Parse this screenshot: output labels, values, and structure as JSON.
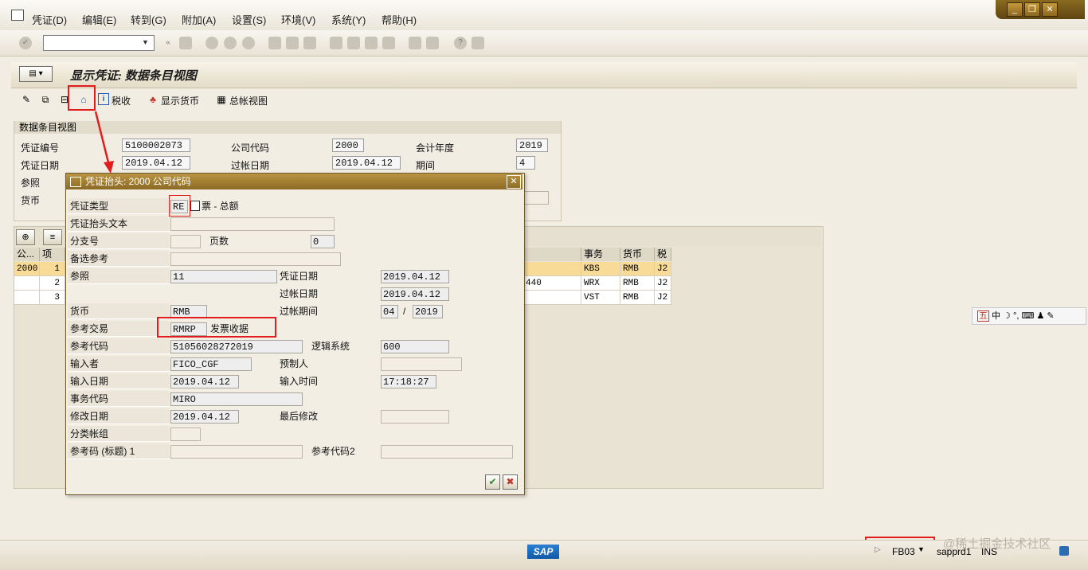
{
  "menu": {
    "items": [
      "凭证(D)",
      "编辑(E)",
      "转到(G)",
      "附加(A)",
      "设置(S)",
      "环境(V)",
      "系统(Y)",
      "帮助(H)"
    ]
  },
  "title": "显示凭证: 数据条目视图",
  "app_toolbar": {
    "tax_label": "税收",
    "show_currency_label": "显示货币",
    "gl_view_label": "总帐视图"
  },
  "header_group": {
    "title": "数据条目视图",
    "doc_no_label": "凭证编号",
    "doc_no": "5100002073",
    "company_label": "公司代码",
    "company": "2000",
    "fiscal_year_label": "会计年度",
    "fiscal_year": "2019",
    "doc_date_label": "凭证日期",
    "doc_date": "2019.04.12",
    "posting_date_label": "过帐日期",
    "posting_date": "2019.04.12",
    "period_label": "期间",
    "period": "4",
    "reference_label": "参照",
    "currency_label": "货币"
  },
  "table": {
    "headers": [
      "公...",
      "项",
      "事务",
      "货币",
      "税"
    ],
    "rows": [
      {
        "company": "2000",
        "item": "1",
        "amount_tail": "",
        "trans": "KBS",
        "curr": "RMB",
        "tax": "J2"
      },
      {
        "company": "",
        "item": "2",
        "amount_tail": "440",
        "trans": "WRX",
        "curr": "RMB",
        "tax": "J2"
      },
      {
        "company": "",
        "item": "3",
        "amount_tail": "",
        "trans": "VST",
        "curr": "RMB",
        "tax": "J2"
      }
    ]
  },
  "dialog": {
    "title": "凭证抬头: 2000 公司代码",
    "doc_type_label": "凭证类型",
    "doc_type": "RE",
    "doc_type_desc": "票 - 总额",
    "header_text_label": "凭证抬头文本",
    "branch_label": "分支号",
    "pages_label": "页数",
    "pages": "0",
    "alt_ref_label": "备选参考",
    "reference_label": "参照",
    "reference": "11",
    "doc_date_label": "凭证日期",
    "doc_date": "2019.04.12",
    "posting_date_label": "过帐日期",
    "posting_date": "2019.04.12",
    "currency_label": "货币",
    "currency": "RMB",
    "posting_period_label": "过帐期间",
    "posting_period": "04",
    "posting_year": "2019",
    "ref_trans_label": "参考交易",
    "ref_trans": "RMRP",
    "ref_trans_desc": "发票收据",
    "ref_key_label": "参考代码",
    "ref_key": "51056028272019",
    "logical_system_label": "逻辑系统",
    "logical_system": "600",
    "entered_by_label": "输入者",
    "entered_by": "FICO_CGF",
    "parked_by_label": "预制人",
    "entry_date_label": "输入日期",
    "entry_date": "2019.04.12",
    "entry_time_label": "输入时间",
    "entry_time": "17:18:27",
    "tcode_label": "事务代码",
    "tcode": "MIRO",
    "changed_on_label": "修改日期",
    "changed_on": "2019.04.12",
    "last_change_label": "最后修改",
    "ledger_group_label": "分类帐组",
    "ref_key_h1_label": "参考码 (标题) 1",
    "ref_key2_label": "参考代码2"
  },
  "status": {
    "sap": "SAP",
    "tcode": "FB03",
    "server": "sapprd1",
    "mode": "INS",
    "watermark": "@稀土掘金技术社区"
  },
  "ime": {
    "label": "五中"
  },
  "colors": {
    "annotation": "#e21c1c",
    "title_bar": "#8c6a24",
    "highlight": "#f9db98"
  }
}
